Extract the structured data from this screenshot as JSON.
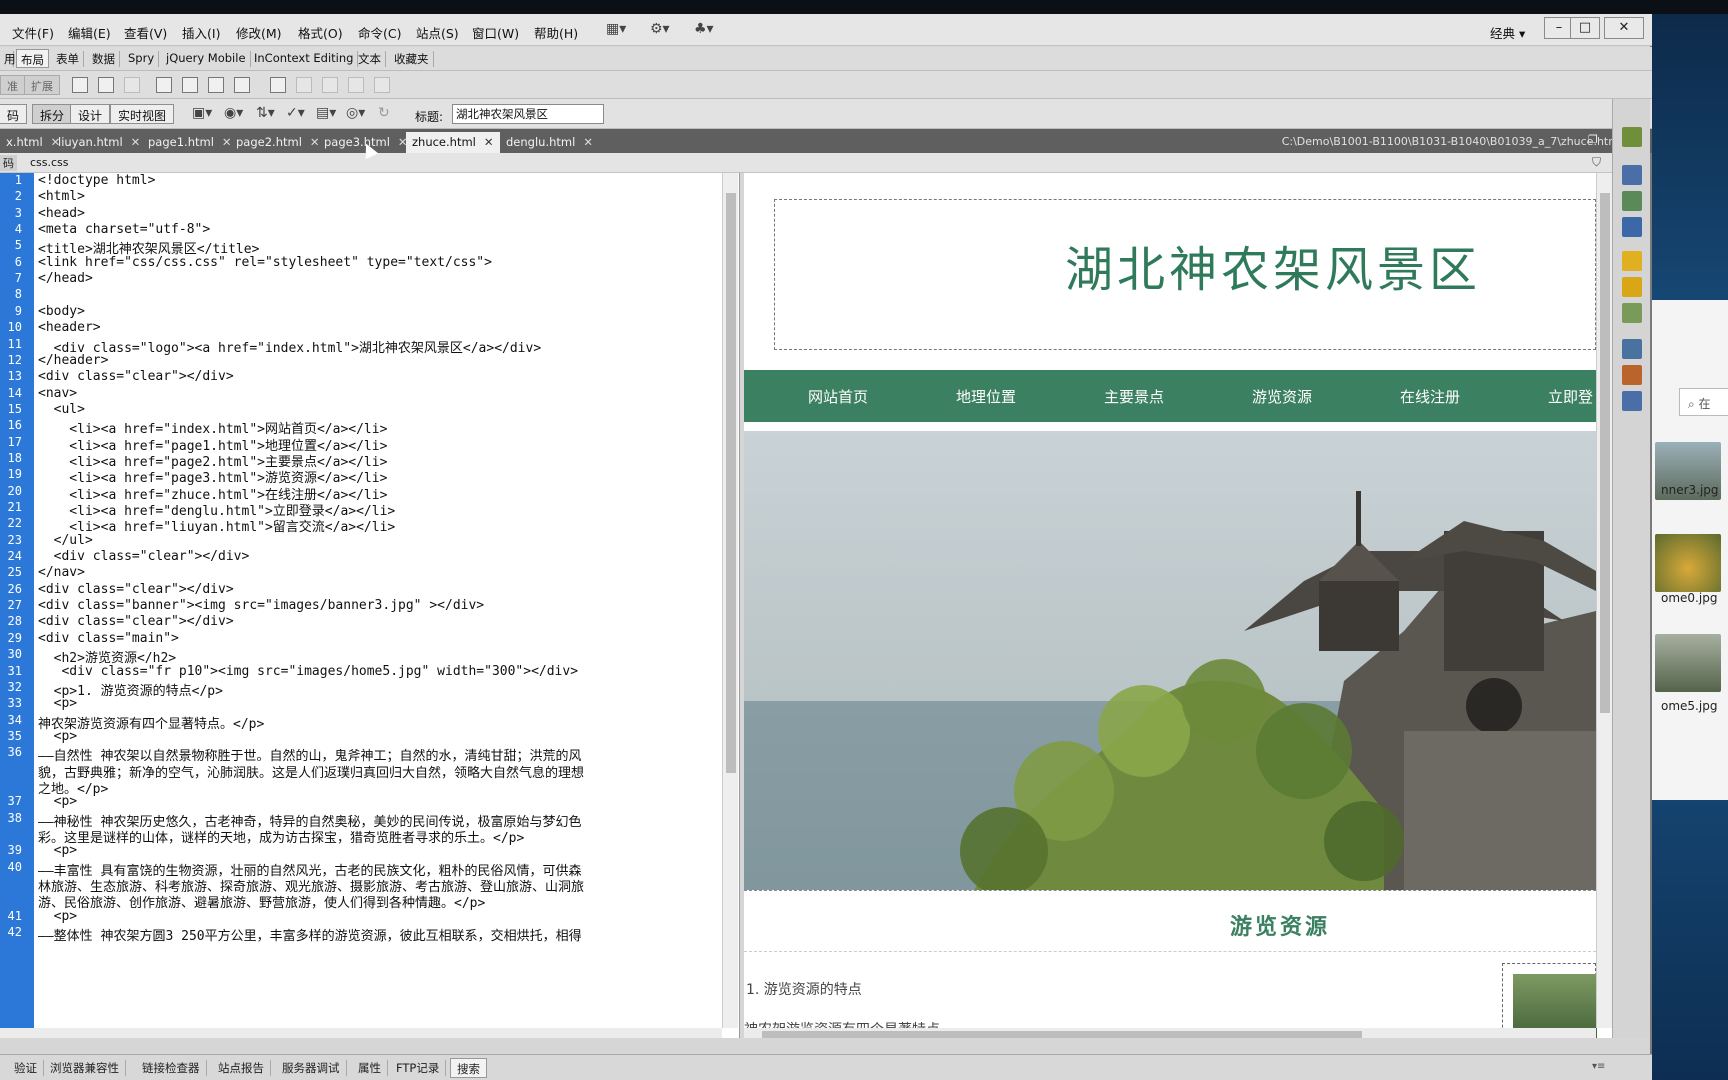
{
  "menu": {
    "items": [
      "文件(F)",
      "编辑(E)",
      "查看(V)",
      "插入(I)",
      "修改(M)",
      "格式(O)",
      "命令(C)",
      "站点(S)",
      "窗口(W)",
      "帮助(H)"
    ],
    "workspace_label": "经典",
    "controls": {
      "minimize": "–",
      "maximize": "□",
      "close": "✕"
    }
  },
  "insert_tabs": [
    "布局",
    "表单",
    "数据",
    "Spry",
    "jQuery Mobile",
    "InContext Editing",
    "文本",
    "收藏夹"
  ],
  "iconbar_buttons": {
    "standard": "准",
    "expanded": "扩展"
  },
  "view_buttons": {
    "code": "码",
    "split": "拆分",
    "design": "设计",
    "live": "实时视图"
  },
  "doc_title": {
    "label": "标题:",
    "value": "湖北神农架风景区"
  },
  "doc_tabs": [
    "x.html",
    "liuyan.html",
    "page1.html",
    "page2.html",
    "page3.html",
    "zhuce.html",
    "denglu.html"
  ],
  "selected_tab_index": 5,
  "file_path": "C:\\Demo\\B1001-B1100\\B1031-B1040\\B01039_a_7\\zhuce.html",
  "related_file": "css.css",
  "code_lines": [
    {
      "n": "1",
      "text": "<!doctype html>"
    },
    {
      "n": "2",
      "text": "<html>"
    },
    {
      "n": "3",
      "text": "<head>"
    },
    {
      "n": "4",
      "text": "<meta charset=\"utf-8\">"
    },
    {
      "n": "5",
      "text": "<title>湖北神农架风景区</title>"
    },
    {
      "n": "6",
      "text": "<link href=\"css/css.css\" rel=\"stylesheet\" type=\"text/css\">"
    },
    {
      "n": "7",
      "text": "</head>"
    },
    {
      "n": "8",
      "text": ""
    },
    {
      "n": "9",
      "text": "<body>"
    },
    {
      "n": "10",
      "text": "<header>"
    },
    {
      "n": "11",
      "text": "  <div class=\"logo\"><a href=\"index.html\">湖北神农架风景区</a></div>"
    },
    {
      "n": "12",
      "text": "</header>"
    },
    {
      "n": "13",
      "text": "<div class=\"clear\"></div>"
    },
    {
      "n": "14",
      "text": "<nav>"
    },
    {
      "n": "15",
      "text": "  <ul>"
    },
    {
      "n": "16",
      "text": "    <li><a href=\"index.html\">网站首页</a></li>"
    },
    {
      "n": "17",
      "text": "    <li><a href=\"page1.html\">地理位置</a></li>"
    },
    {
      "n": "18",
      "text": "    <li><a href=\"page2.html\">主要景点</a></li>"
    },
    {
      "n": "19",
      "text": "    <li><a href=\"page3.html\">游览资源</a></li>"
    },
    {
      "n": "20",
      "text": "    <li><a href=\"zhuce.html\">在线注册</a></li>"
    },
    {
      "n": "21",
      "text": "    <li><a href=\"denglu.html\">立即登录</a></li>"
    },
    {
      "n": "22",
      "text": "    <li><a href=\"liuyan.html\">留言交流</a></li>"
    },
    {
      "n": "23",
      "text": "  </ul>"
    },
    {
      "n": "24",
      "text": "  <div class=\"clear\"></div>"
    },
    {
      "n": "25",
      "text": "</nav>"
    },
    {
      "n": "26",
      "text": "<div class=\"clear\"></div>"
    },
    {
      "n": "27",
      "text": "<div class=\"banner\"><img src=\"images/banner3.jpg\" ></div>"
    },
    {
      "n": "28",
      "text": "<div class=\"clear\"></div>"
    },
    {
      "n": "29",
      "text": "<div class=\"main\">"
    },
    {
      "n": "30",
      "text": "  <h2>游览资源</h2>"
    },
    {
      "n": "31",
      "text": "   <div class=\"fr p10\"><img src=\"images/home5.jpg\" width=\"300\"></div>"
    },
    {
      "n": "32",
      "text": "  <p>1. 游览资源的特点</p>"
    },
    {
      "n": "33",
      "text": "  <p>"
    },
    {
      "n": "34",
      "text": "神农架游览资源有四个显著特点。</p>"
    },
    {
      "n": "35",
      "text": "  <p>"
    },
    {
      "n": "36",
      "text": "——自然性 神农架以自然景物称胜于世。自然的山，鬼斧神工；自然的水，清纯甘甜；洪荒的风"
    },
    {
      "n": "",
      "text": "貌，古野典雅；新净的空气，沁肺润肤。这是人们返璞归真回归大自然，领略大自然气息的理想"
    },
    {
      "n": "",
      "text": "之地。</p>"
    },
    {
      "n": "37",
      "text": "  <p>"
    },
    {
      "n": "38",
      "text": "——神秘性 神农架历史悠久，古老神奇，特异的自然奥秘，美妙的民间传说，极富原始与梦幻色"
    },
    {
      "n": "",
      "text": "彩。这里是谜样的山体，谜样的天地，成为访古探宝，猎奇览胜者寻求的乐土。</p>"
    },
    {
      "n": "39",
      "text": "  <p>"
    },
    {
      "n": "40",
      "text": "——丰富性 具有富饶的生物资源，壮丽的自然风光，古老的民族文化，粗朴的民俗风情，可供森"
    },
    {
      "n": "",
      "text": "林旅游、生态旅游、科考旅游、探奇旅游、观光旅游、摄影旅游、考古旅游、登山旅游、山洞旅"
    },
    {
      "n": "",
      "text": "游、民俗旅游、创作旅游、避暑旅游、野营旅游，使人们得到各种情趣。</p>"
    },
    {
      "n": "41",
      "text": "  <p>"
    },
    {
      "n": "42",
      "text": "——整体性 神农架方圆3 250平方公里，丰富多样的游览资源，彼此互相联系，交相烘托，相得"
    }
  ],
  "design": {
    "site_title": "湖北神农架风景区",
    "nav": [
      "网站首页",
      "地理位置",
      "主要景点",
      "游览资源",
      "在线注册",
      "立即登"
    ],
    "section_title": "游览资源",
    "para1": "1. 游览资源的特点",
    "para2": "神农架游览资源有四个显著特点"
  },
  "status_tabs": [
    "验证",
    "浏览器兼容性",
    "链接检查器",
    "站点报告",
    "服务器调试",
    "属性",
    "FTP记录",
    "搜索"
  ],
  "status_active_index": 7,
  "explorer": {
    "search_placeholder": "在",
    "files": [
      "nner3.jpg",
      "ome0.jpg",
      "ome5.jpg"
    ]
  },
  "colors": {
    "accent_green": "#3b8060",
    "gutter_blue": "#2b78d8",
    "title_green": "#2e7a5a"
  }
}
